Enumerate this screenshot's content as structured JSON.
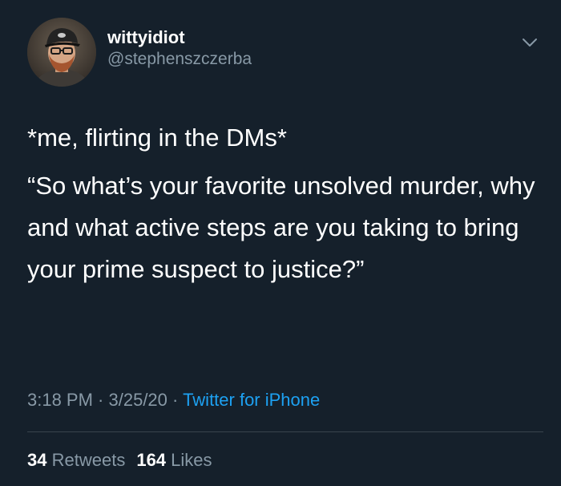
{
  "user": {
    "display_name": "wittyidiot",
    "handle": "@stephenszczerba"
  },
  "tweet": {
    "line1": "*me, flirting in the DMs*",
    "line2": "“So what’s your favorite unsolved murder, why and what active steps are you taking to bring your prime suspect to justice?”"
  },
  "meta": {
    "time": "3:18 PM",
    "sep1": " · ",
    "date": "3/25/20",
    "sep2": " · ",
    "source": "Twitter for iPhone"
  },
  "stats": {
    "retweets_count": "34",
    "retweets_label": "Retweets",
    "likes_count": "164",
    "likes_label": "Likes"
  },
  "colors": {
    "background": "#15202b",
    "text": "#ffffff",
    "muted": "#8899a6",
    "link": "#1da1f2",
    "divider": "#38444d"
  },
  "icons": {
    "menu": "chevron-down-icon"
  }
}
